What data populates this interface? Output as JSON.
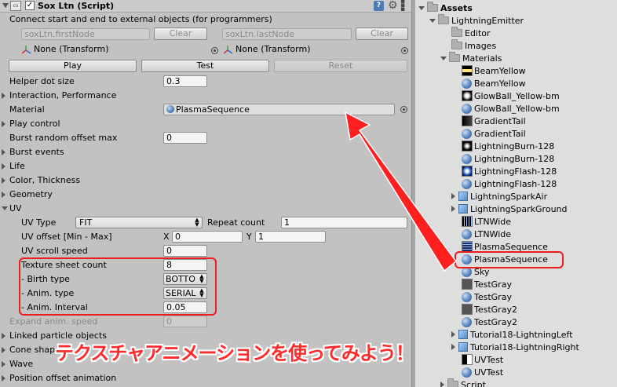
{
  "inspector": {
    "component_title": "Sox Ltn (Script)",
    "script_icon_text": "cs",
    "enabled_checkmark": "✓",
    "help_icon_text": "?",
    "description": "Connect start and end to external objects (for programmers)",
    "first_node_field": "soxLtn.firstNode",
    "last_node_field": "soxLtn.lastNode",
    "clear_label": "Clear",
    "first_transform": "None (Transform)",
    "last_transform": "None (Transform)",
    "play_label": "Play",
    "test_label": "Test",
    "reset_label": "Reset",
    "helper_dot_size_label": "Helper dot size",
    "helper_dot_size_value": "0.3",
    "interaction_label": "Interaction, Performance",
    "material_label": "Material",
    "material_value": "PlasmaSequence",
    "play_control_label": "Play control",
    "burst_offset_label": "Burst random offset max",
    "burst_offset_value": "0",
    "burst_events_label": "Burst events",
    "life_label": "Life",
    "color_label": "Color, Thickness",
    "geometry_label": "Geometry",
    "uv_label": "UV",
    "uv_type_label": "UV Type",
    "uv_type_value": "FIT",
    "repeat_count_label": "Repeat count",
    "repeat_count_value": "1",
    "uv_offset_label": "UV offset [Min - Max]",
    "uv_offset_x_label": "X",
    "uv_offset_x_value": "0",
    "uv_offset_y_label": "Y",
    "uv_offset_y_value": "1",
    "uv_scroll_label": "UV scroll speed",
    "uv_scroll_value": "0",
    "texture_sheet_label": "Texture sheet count",
    "texture_sheet_value": "8",
    "birth_type_label": "- Birth type",
    "birth_type_value": "BOTTO",
    "anim_type_label": "- Anim. type",
    "anim_type_value": "SERIAL",
    "anim_interval_label": "- Anim. Interval",
    "anim_interval_value": "0.05",
    "expand_anim_label": "Expand anim. speed",
    "expand_anim_value": "0",
    "linked_particle_label": "Linked particle objects",
    "cone_shape_label": "Cone shap",
    "wave_label": "Wave",
    "position_offset_label": "Position offset animation"
  },
  "project": {
    "assets_label": "Assets",
    "lightning_emitter_label": "LightningEmitter",
    "editor_label": "Editor",
    "images_label": "Images",
    "materials_label": "Materials",
    "items": [
      {
        "label": "BeamYellow",
        "icon": "texture-beam-yellow-icon"
      },
      {
        "label": "BeamYellow",
        "icon": "material-sphere-icon"
      },
      {
        "label": "GlowBall_Yellow-bm",
        "icon": "texture-glowball-icon"
      },
      {
        "label": "GlowBall_Yellow-bm",
        "icon": "material-sphere-icon"
      },
      {
        "label": "GradientTail",
        "icon": "texture-gradient-icon"
      },
      {
        "label": "GradientTail",
        "icon": "material-sphere-icon"
      },
      {
        "label": "LightningBurn-128",
        "icon": "texture-burn-icon"
      },
      {
        "label": "LightningBurn-128",
        "icon": "material-sphere-icon"
      },
      {
        "label": "LightningFlash-128",
        "icon": "texture-flash-icon"
      },
      {
        "label": "LightningFlash-128",
        "icon": "material-sphere-icon"
      },
      {
        "label": "LightningSparkAir",
        "icon": "prefab-cube-icon"
      },
      {
        "label": "LightningSparkGround",
        "icon": "prefab-cube-icon"
      },
      {
        "label": "LTNWide",
        "icon": "texture-ltnwide-icon"
      },
      {
        "label": "LTNWide",
        "icon": "material-sphere-icon"
      },
      {
        "label": "PlasmaSequence",
        "icon": "texture-plasma-icon"
      },
      {
        "label": "PlasmaSequence",
        "icon": "material-sphere-icon"
      },
      {
        "label": "Sky",
        "icon": "material-sphere-icon"
      },
      {
        "label": "TestGray",
        "icon": "texture-gray-icon"
      },
      {
        "label": "TestGray",
        "icon": "material-sphere-icon"
      },
      {
        "label": "TestGray2",
        "icon": "texture-gray-icon"
      },
      {
        "label": "TestGray2",
        "icon": "material-sphere-icon"
      },
      {
        "label": "Tutorial18-LightningLeft",
        "icon": "prefab-cube-icon"
      },
      {
        "label": "Tutorial18-LightningRight",
        "icon": "prefab-cube-icon"
      },
      {
        "label": "UVTest",
        "icon": "texture-uvtest-icon"
      },
      {
        "label": "UVTest",
        "icon": "material-sphere-icon"
      }
    ],
    "script_label": "Script"
  },
  "annotation": {
    "caption": "テクスチャアニメーションを使ってみよう！",
    "color": "#ee1d1d"
  }
}
